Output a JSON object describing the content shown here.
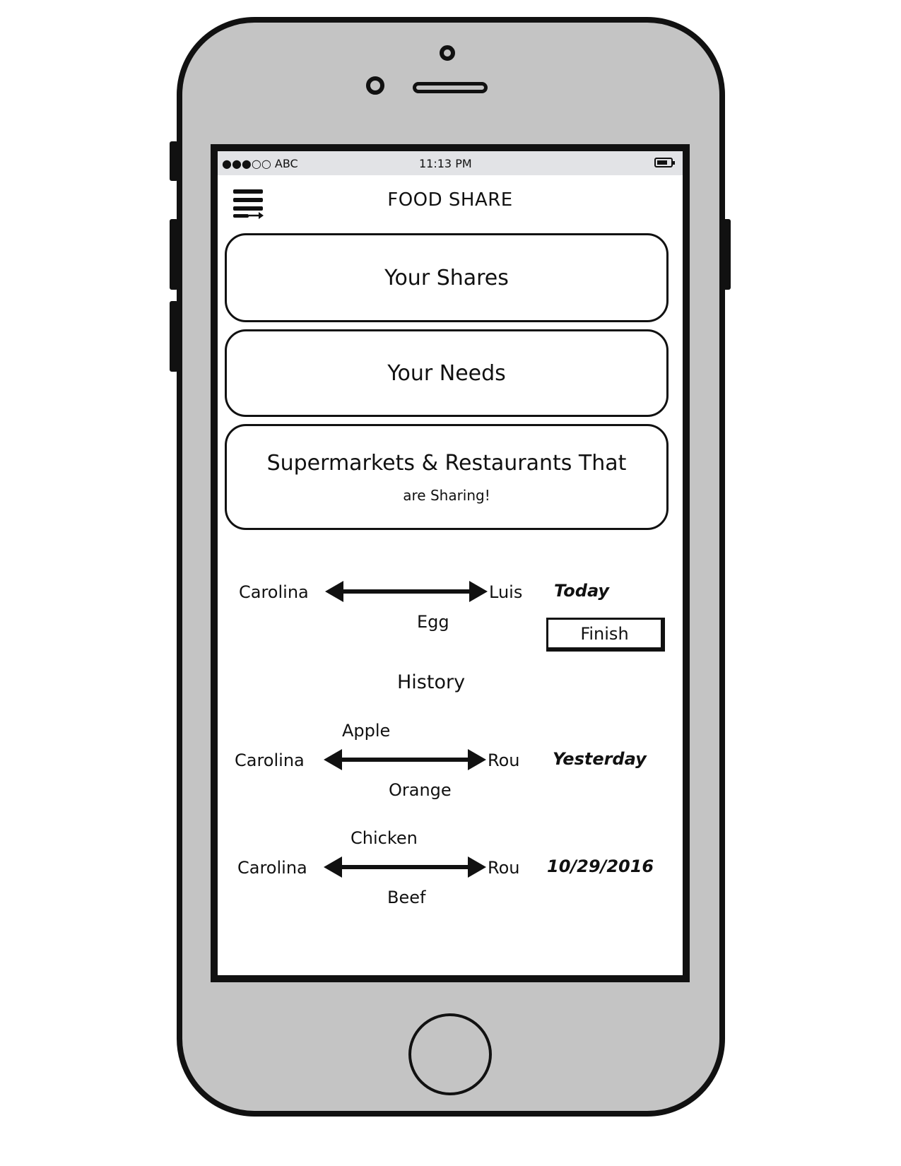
{
  "status_bar": {
    "carrier": "●●●○○ ABC",
    "time": "11:13 PM",
    "battery_icon": "battery-icon"
  },
  "header": {
    "menu_icon": "hamburger-menu-icon",
    "title": "FOOD SHARE"
  },
  "cards": {
    "shares_label": "Your Shares",
    "needs_label": "Your Needs",
    "partners_label": "Supermarkets & Restaurants That",
    "partners_sub": "are Sharing!"
  },
  "current_exchange": {
    "from": "Carolina",
    "to": "Luis",
    "item": "Egg",
    "when": "Today",
    "finish_label": "Finish"
  },
  "history": {
    "heading": "History",
    "entries": [
      {
        "from": "Carolina",
        "to": "Rou",
        "item_top": "Apple",
        "item_bottom": "Orange",
        "when": "Yesterday"
      },
      {
        "from": "Carolina",
        "to": "Rou",
        "item_top": "Chicken",
        "item_bottom": "Beef",
        "when": "10/29/2016"
      }
    ]
  },
  "colors": {
    "phone_body": "#c4c4c4",
    "outline": "#111111",
    "status_bar_bg": "#e2e3e6",
    "screen_bg": "#ffffff"
  }
}
